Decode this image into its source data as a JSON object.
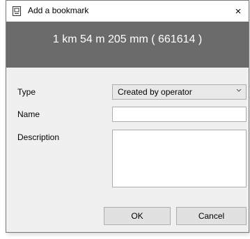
{
  "window": {
    "title": "Add a bookmark",
    "close_label": "×"
  },
  "header": {
    "position_text": "1 km 54 m 205 mm ( 661614 )"
  },
  "form": {
    "type_label": "Type",
    "type_value": "Created by operator",
    "name_label": "Name",
    "name_value": "",
    "description_label": "Description",
    "description_value": ""
  },
  "buttons": {
    "ok_label": "OK",
    "cancel_label": "Cancel"
  },
  "icons": {
    "title_icon": "bookmark-dialog-icon",
    "dropdown_icon": "chevron-down-icon"
  },
  "colors": {
    "header_band": "#6b6b6b",
    "header_text": "#ffffff"
  }
}
